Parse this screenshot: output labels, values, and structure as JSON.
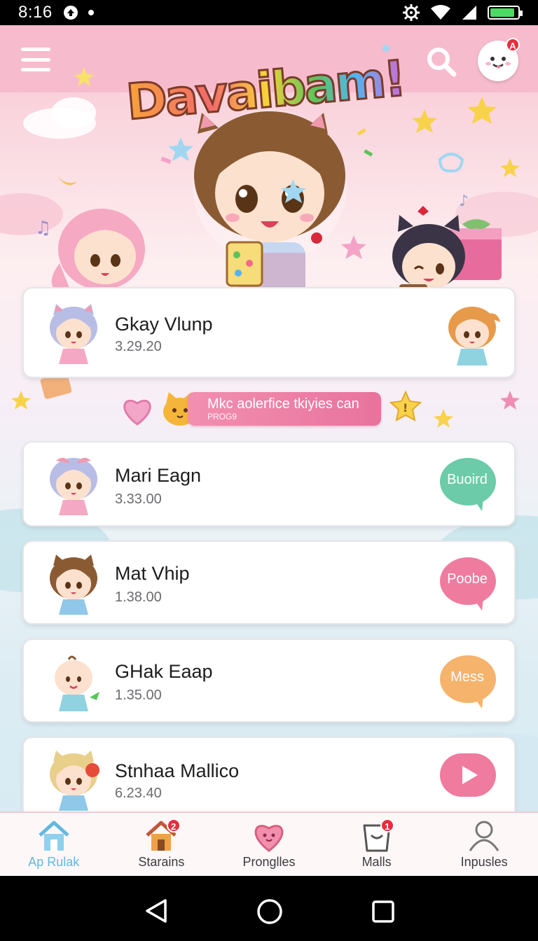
{
  "status_bar": {
    "time": "8:16",
    "battery_color": "#4cd964"
  },
  "header": {
    "app_title": "Davaibam!",
    "menu_icon": "hamburger-menu-icon",
    "search_icon": "search-icon",
    "profile_icon": "profile-avatar-icon",
    "profile_badge": "A"
  },
  "cards": [
    {
      "name": "Gkay Vlunp",
      "sub": "3.29.20"
    },
    {
      "name": "Mari Eagn",
      "sub": "3.33.00",
      "action": "Buoird",
      "action_color": "#6ccba8"
    },
    {
      "name": "Mat Vhip",
      "sub": "1.38.00",
      "action": "Poobe",
      "action_color": "#ef7b9f"
    },
    {
      "name": "GHak Eaap",
      "sub": "1.35.00",
      "action": "Mess",
      "action_color": "#f5b36c"
    },
    {
      "name": "Stnhaa Mallico",
      "sub": "6.23.40",
      "action_icon": "play-icon",
      "action_color": "#ef7b9f"
    }
  ],
  "promo": {
    "title": "Mkc aolerfice tkiyies can",
    "subtitle": "PROG9"
  },
  "bottom_nav": [
    {
      "label": "Ap Rulak",
      "icon": "home-icon",
      "active": true
    },
    {
      "label": "Starains",
      "icon": "house-icon",
      "badge": "2"
    },
    {
      "label": "Pronglles",
      "icon": "heart-icon"
    },
    {
      "label": "Malls",
      "icon": "basket-icon",
      "badge": "1"
    },
    {
      "label": "Inpusles",
      "icon": "user-icon"
    }
  ],
  "colors": {
    "accent_pink": "#ef7b9f",
    "active_nav": "#63b8e0"
  }
}
